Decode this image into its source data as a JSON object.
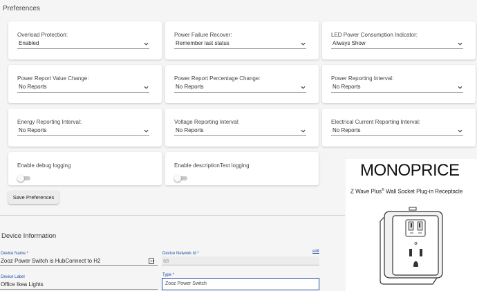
{
  "preferences": {
    "title": "Preferences",
    "settings": [
      {
        "label": "Overload Protection:",
        "value": "Enabled"
      },
      {
        "label": "Power Failure Recover:",
        "value": "Remember last status"
      },
      {
        "label": "LED Power Consumption Indicator:",
        "value": "Always Show"
      },
      {
        "label": "Power Report Value Change:",
        "value": "No Reports"
      },
      {
        "label": "Power Report Percentage Change:",
        "value": "No Reports"
      },
      {
        "label": "Power Reporting Interval:",
        "value": "No Reports"
      },
      {
        "label": "Energy Reporting Interval:",
        "value": "No Reports"
      },
      {
        "label": "Voltage Reporting Interval:",
        "value": "No Reports"
      },
      {
        "label": "Electrical Current Reporting Interval:",
        "value": "No Reports"
      }
    ],
    "toggles": [
      {
        "label": "Enable debug logging",
        "on": false
      },
      {
        "label": "Enable descriptionText logging",
        "on": false
      }
    ],
    "save_label": "Save Preferences",
    "icons": {
      "select": "chevron-down-icon"
    }
  },
  "device_info": {
    "title": "Device Information",
    "device_name": {
      "label": "Device Name *",
      "value": "Zooz Power Switch is HubConnect to H2"
    },
    "network_id": {
      "label": "Device Network Id *",
      "value": "68",
      "edit_label": "edit"
    },
    "device_label": {
      "label": "Device Label",
      "value": "Office Ikea Lights"
    },
    "type": {
      "label": "Type *",
      "value": "Zooz Power Switch"
    },
    "icons": {
      "name_field": "clipboard-icon"
    }
  },
  "product_image": {
    "brand": "MONOPRICE",
    "tagline_part1": "Z Wave Plus",
    "tagline_sup": "®",
    "tagline_part2": " Wall Socket Plug-in Receptacle"
  },
  "colors": {
    "accent": "#1e4fa8",
    "card": "#ffffff",
    "background": "#f5f5f5"
  }
}
